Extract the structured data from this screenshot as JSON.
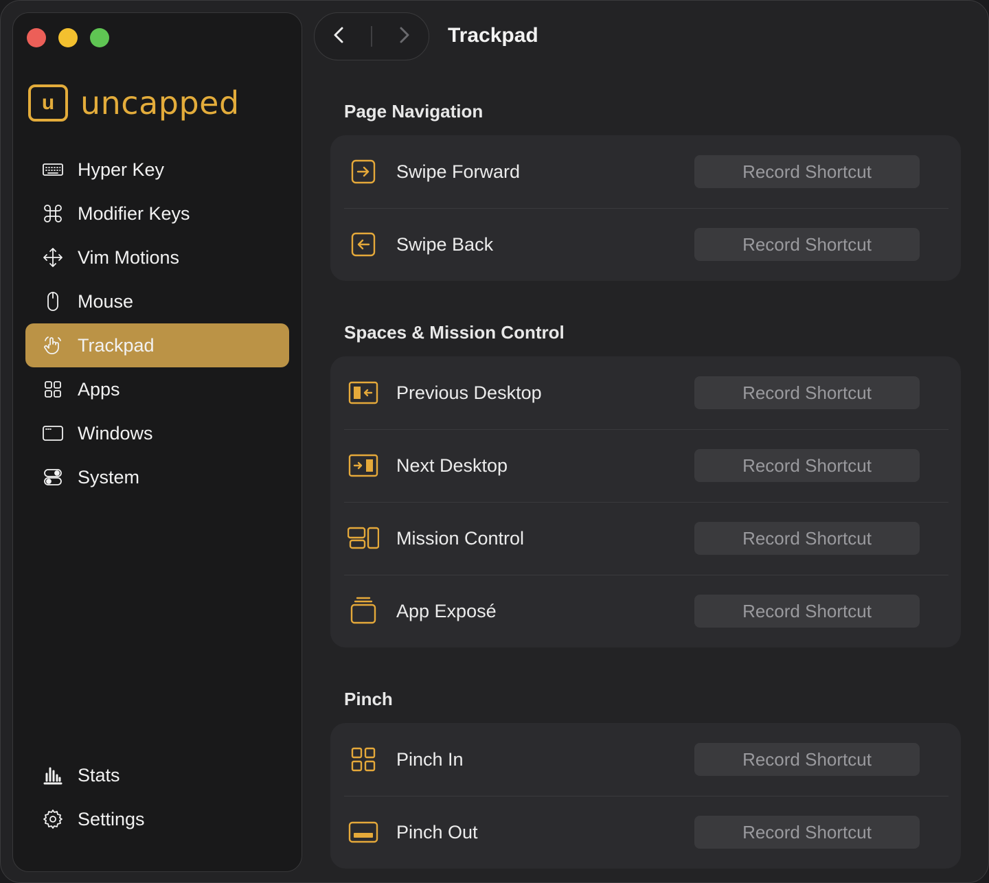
{
  "app": {
    "name": "uncapped",
    "logo_letter": "u"
  },
  "header": {
    "title": "Trackpad"
  },
  "sidebar": {
    "items": [
      {
        "id": "hyper-key",
        "label": "Hyper Key",
        "icon": "keyboard-icon"
      },
      {
        "id": "modifier-keys",
        "label": "Modifier Keys",
        "icon": "command-icon"
      },
      {
        "id": "vim-motions",
        "label": "Vim Motions",
        "icon": "move-arrows-icon"
      },
      {
        "id": "mouse",
        "label": "Mouse",
        "icon": "mouse-icon"
      },
      {
        "id": "trackpad",
        "label": "Trackpad",
        "icon": "hand-pointer-icon",
        "active": true
      },
      {
        "id": "apps",
        "label": "Apps",
        "icon": "grid-icon"
      },
      {
        "id": "windows",
        "label": "Windows",
        "icon": "window-icon"
      },
      {
        "id": "system",
        "label": "System",
        "icon": "toggles-icon"
      }
    ],
    "bottom_items": [
      {
        "id": "stats",
        "label": "Stats",
        "icon": "bar-chart-icon"
      },
      {
        "id": "settings",
        "label": "Settings",
        "icon": "gear-icon"
      }
    ]
  },
  "sections": [
    {
      "title": "Page Navigation",
      "rows": [
        {
          "label": "Swipe Forward",
          "icon": "arrow-right-box-icon",
          "button": "Record Shortcut"
        },
        {
          "label": "Swipe Back",
          "icon": "arrow-left-box-icon",
          "button": "Record Shortcut"
        }
      ]
    },
    {
      "title": "Spaces & Mission Control",
      "rows": [
        {
          "label": "Previous Desktop",
          "icon": "previous-desktop-icon",
          "button": "Record Shortcut"
        },
        {
          "label": "Next Desktop",
          "icon": "next-desktop-icon",
          "button": "Record Shortcut"
        },
        {
          "label": "Mission Control",
          "icon": "mission-control-icon",
          "button": "Record Shortcut"
        },
        {
          "label": "App Exposé",
          "icon": "app-expose-icon",
          "button": "Record Shortcut"
        }
      ]
    },
    {
      "title": "Pinch",
      "rows": [
        {
          "label": "Pinch In",
          "icon": "pinch-in-grid-icon",
          "button": "Record Shortcut"
        },
        {
          "label": "Pinch Out",
          "icon": "pinch-out-screen-icon",
          "button": "Record Shortcut"
        }
      ]
    }
  ],
  "colors": {
    "accent": "#e3ac3b",
    "active_bg": "#bb9346",
    "window_bg": "#232325",
    "sidebar_bg": "#19191a",
    "card_bg": "#2b2b2e"
  }
}
